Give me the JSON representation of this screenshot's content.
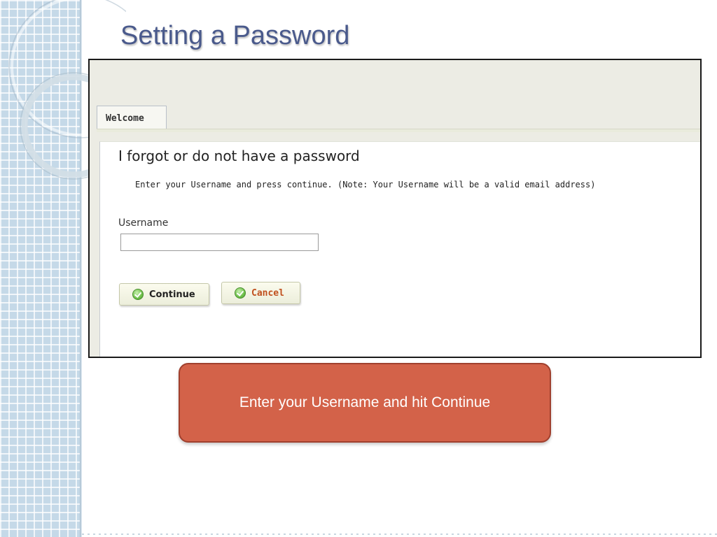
{
  "slide": {
    "title": "Setting a Password"
  },
  "app": {
    "tabs": [
      {
        "label": "Welcome",
        "active": true
      }
    ],
    "form": {
      "heading": "I forgot or do not have a password",
      "instruction": "Enter your Username and press continue. (Note: Your Username will be a valid email address)",
      "username_label": "Username",
      "username_value": "",
      "continue_label": "Continue",
      "cancel_label": "Cancel"
    }
  },
  "callout": {
    "text": "Enter your Username and hit Continue"
  },
  "colors": {
    "title": "#4a5a8c",
    "callout_fill": "#d36249",
    "callout_border": "#a0402e",
    "cancel_text": "#c0501e",
    "button_fill": "#f4f5e4",
    "side_strip": "#c5d9e8"
  },
  "icons": {
    "button_icon": "check-circle-icon"
  }
}
